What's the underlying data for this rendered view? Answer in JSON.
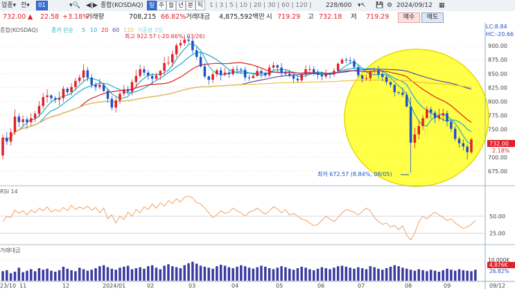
{
  "toolbar": {
    "item1": "업종",
    "item2": "전",
    "date_code": "01",
    "market_label": "종합(KOSDAQ)",
    "tab_day": "일",
    "tab_week": "주",
    "tab_month": "월",
    "tab_year": "년",
    "tab_min": "분",
    "tab_tick": "틱",
    "periods": [
      "1",
      "3",
      "5",
      "10",
      "20",
      "30",
      "60",
      "120"
    ],
    "count": "228/600",
    "date": "2024/09/12"
  },
  "info": {
    "price": "732.00",
    "price_arrow": "▲",
    "change": "22.58",
    "change_pct": "+3.18%",
    "volume_label": "거래량",
    "volume": "708,215",
    "ratio": "66.82%",
    "amount_label": "거래대금",
    "amount": "4,875,592백만",
    "open_label": "시",
    "open": "719.29",
    "high_label": "고",
    "high": "732.18",
    "low_label": "저",
    "low": "719.29",
    "buy": "매수",
    "sell": "매도"
  },
  "legend": {
    "name": "종합(KOSDAQ)",
    "ma_label": "종가 단순",
    "ma5": "5",
    "ma10": "10",
    "ma20": "20",
    "ma60": "60",
    "ma120": "120",
    "extra": "가중평 3일",
    "lc": "LC:8.84",
    "hc": "HC:-20.66",
    "max_annotation": "최고 922.57 (-20.66%, 03/26)",
    "min_annotation": "최저 672.57 (8.84%, 08/05)",
    "last_price_tag": "732.00",
    "last_pct_tag": "2.18%",
    "rsi_label": "RSI 14",
    "vol_label": "거래대금",
    "vol_last_tag": "4,876K",
    "vol_pct_tag": "26.82%"
  },
  "colors": {
    "up": "#e0202a",
    "down": "#1f52c7",
    "ma5": "#20b0b0",
    "ma10": "#1aa8d8",
    "ma20": "#e02020",
    "ma60": "#5a4aa8",
    "ma120": "#f0c040",
    "highlight": "#ffff00",
    "rsi": "#f2a060",
    "volume": "#3a3aa0"
  },
  "chart_data": {
    "type": "candlestick",
    "price_axis": {
      "ticks": [
        "900.00",
        "875.00",
        "850.00",
        "825.00",
        "800.00",
        "775.00",
        "750.00",
        "725.00",
        "700.00",
        "675.00"
      ],
      "range": [
        655,
        935
      ]
    },
    "rsi_axis": {
      "ticks": [
        "50.00",
        "25.00"
      ],
      "range": [
        10,
        90
      ]
    },
    "volume_axis": {
      "ticks": [
        "10,000K"
      ]
    },
    "x_ticks": [
      "23/10",
      "11",
      "12",
      "2024/01",
      "02",
      "03",
      "04",
      "05",
      "06",
      "07",
      "08",
      "09",
      "09/12"
    ],
    "candles": [
      [
        703,
        735,
        696,
        741,
        "up"
      ],
      [
        735,
        728,
        722,
        745,
        "down"
      ],
      [
        728,
        745,
        721,
        752,
        "up"
      ],
      [
        745,
        773,
        740,
        786,
        "up"
      ],
      [
        773,
        763,
        754,
        779,
        "down"
      ],
      [
        763,
        768,
        756,
        775,
        "up"
      ],
      [
        768,
        763,
        751,
        773,
        "down"
      ],
      [
        763,
        770,
        756,
        779,
        "up"
      ],
      [
        770,
        778,
        763,
        783,
        "up"
      ],
      [
        778,
        792,
        772,
        801,
        "up"
      ],
      [
        792,
        808,
        786,
        815,
        "up"
      ],
      [
        808,
        811,
        798,
        822,
        "up"
      ],
      [
        811,
        806,
        799,
        813,
        "down"
      ],
      [
        806,
        803,
        797,
        810,
        "down"
      ],
      [
        803,
        806,
        793,
        818,
        "up"
      ],
      [
        806,
        823,
        799,
        828,
        "up"
      ],
      [
        823,
        817,
        812,
        826,
        "down"
      ],
      [
        817,
        826,
        811,
        833,
        "up"
      ],
      [
        826,
        837,
        820,
        842,
        "up"
      ],
      [
        837,
        843,
        832,
        848,
        "up"
      ],
      [
        843,
        856,
        836,
        867,
        "up"
      ],
      [
        856,
        843,
        836,
        862,
        "down"
      ],
      [
        843,
        830,
        824,
        849,
        "down"
      ],
      [
        830,
        826,
        819,
        834,
        "down"
      ],
      [
        826,
        830,
        822,
        841,
        "up"
      ],
      [
        830,
        819,
        817,
        833,
        "down"
      ],
      [
        819,
        805,
        798,
        823,
        "down"
      ],
      [
        805,
        789,
        784,
        810,
        "down"
      ],
      [
        789,
        802,
        780,
        808,
        "up"
      ],
      [
        802,
        814,
        796,
        818,
        "up"
      ],
      [
        814,
        822,
        809,
        830,
        "up"
      ],
      [
        822,
        818,
        812,
        828,
        "down"
      ],
      [
        818,
        835,
        811,
        840,
        "up"
      ],
      [
        835,
        846,
        825,
        857,
        "up"
      ],
      [
        846,
        858,
        842,
        866,
        "up"
      ],
      [
        858,
        852,
        846,
        864,
        "down"
      ],
      [
        852,
        846,
        839,
        857,
        "down"
      ],
      [
        846,
        841,
        831,
        851,
        "down"
      ],
      [
        841,
        847,
        838,
        852,
        "up"
      ],
      [
        847,
        855,
        839,
        857,
        "up"
      ],
      [
        855,
        869,
        848,
        880,
        "up"
      ],
      [
        869,
        870,
        865,
        881,
        "up"
      ],
      [
        870,
        885,
        862,
        892,
        "up"
      ],
      [
        885,
        901,
        879,
        905,
        "up"
      ],
      [
        901,
        905,
        896,
        911,
        "up"
      ],
      [
        905,
        911,
        900,
        920,
        "up"
      ],
      [
        911,
        909,
        904,
        918,
        "down"
      ],
      [
        909,
        892,
        886,
        914,
        "down"
      ],
      [
        892,
        880,
        875,
        898,
        "down"
      ],
      [
        880,
        863,
        861,
        888,
        "down"
      ],
      [
        863,
        845,
        841,
        869,
        "down"
      ],
      [
        845,
        839,
        830,
        847,
        "down"
      ],
      [
        839,
        849,
        833,
        853,
        "up"
      ],
      [
        849,
        856,
        844,
        859,
        "up"
      ],
      [
        856,
        848,
        838,
        862,
        "down"
      ],
      [
        848,
        852,
        845,
        860,
        "up"
      ],
      [
        852,
        849,
        842,
        857,
        "down"
      ],
      [
        849,
        858,
        846,
        863,
        "up"
      ],
      [
        858,
        858,
        850,
        864,
        "down"
      ],
      [
        858,
        857,
        850,
        861,
        "down"
      ],
      [
        857,
        843,
        837,
        862,
        "down"
      ],
      [
        843,
        842,
        837,
        848,
        "down"
      ],
      [
        842,
        846,
        842,
        848,
        "up"
      ],
      [
        846,
        855,
        844,
        862,
        "up"
      ],
      [
        855,
        851,
        842,
        858,
        "down"
      ],
      [
        851,
        847,
        843,
        854,
        "down"
      ],
      [
        847,
        861,
        844,
        866,
        "up"
      ],
      [
        861,
        865,
        856,
        871,
        "up"
      ],
      [
        865,
        861,
        853,
        867,
        "down"
      ],
      [
        861,
        851,
        844,
        869,
        "down"
      ],
      [
        851,
        850,
        846,
        857,
        "down"
      ],
      [
        850,
        846,
        843,
        857,
        "down"
      ],
      [
        846,
        841,
        834,
        850,
        "down"
      ],
      [
        841,
        838,
        834,
        846,
        "down"
      ],
      [
        838,
        849,
        835,
        850,
        "up"
      ],
      [
        849,
        858,
        843,
        865,
        "up"
      ],
      [
        858,
        858,
        852,
        865,
        "up"
      ],
      [
        858,
        852,
        846,
        864,
        "down"
      ],
      [
        852,
        848,
        840,
        858,
        "down"
      ],
      [
        848,
        845,
        838,
        854,
        "down"
      ],
      [
        845,
        850,
        841,
        858,
        "up"
      ],
      [
        850,
        849,
        841,
        851,
        "down"
      ],
      [
        849,
        855,
        845,
        860,
        "up"
      ],
      [
        855,
        868,
        852,
        870,
        "up"
      ],
      [
        868,
        875,
        869,
        878,
        "up"
      ],
      [
        875,
        874,
        869,
        879,
        "down"
      ],
      [
        874,
        873,
        867,
        880,
        "down"
      ],
      [
        873,
        862,
        858,
        878,
        "down"
      ],
      [
        862,
        847,
        843,
        866,
        "down"
      ],
      [
        847,
        841,
        834,
        848,
        "down"
      ],
      [
        841,
        842,
        838,
        849,
        "up"
      ],
      [
        842,
        854,
        837,
        856,
        "up"
      ],
      [
        854,
        856,
        850,
        858,
        "up"
      ],
      [
        856,
        849,
        841,
        864,
        "down"
      ],
      [
        849,
        844,
        836,
        856,
        "down"
      ],
      [
        844,
        835,
        830,
        848,
        "down"
      ],
      [
        835,
        830,
        825,
        836,
        "down"
      ],
      [
        830,
        817,
        809,
        831,
        "down"
      ],
      [
        817,
        816,
        812,
        818,
        "down"
      ],
      [
        816,
        812,
        808,
        825,
        "down"
      ],
      [
        812,
        791,
        789,
        817,
        "down"
      ],
      [
        791,
        726,
        672,
        808,
        "down"
      ],
      [
        726,
        741,
        716,
        753,
        "up"
      ],
      [
        741,
        756,
        732,
        766,
        "up"
      ],
      [
        756,
        770,
        749,
        776,
        "up"
      ],
      [
        770,
        786,
        770,
        792,
        "up"
      ],
      [
        786,
        780,
        769,
        791,
        "down"
      ],
      [
        780,
        770,
        761,
        784,
        "down"
      ],
      [
        770,
        775,
        766,
        787,
        "up"
      ],
      [
        775,
        779,
        764,
        787,
        "up"
      ],
      [
        779,
        764,
        755,
        784,
        "down"
      ],
      [
        764,
        751,
        745,
        767,
        "down"
      ],
      [
        751,
        733,
        729,
        756,
        "down"
      ],
      [
        733,
        725,
        717,
        737,
        "down"
      ],
      [
        725,
        719,
        712,
        732,
        "down"
      ],
      [
        719,
        709,
        696,
        723,
        "down"
      ],
      [
        709,
        732,
        706,
        735,
        "up"
      ]
    ],
    "rsi": [
      42,
      50,
      48,
      59,
      54,
      58,
      52,
      59,
      55,
      62,
      58,
      64,
      56,
      60,
      57,
      63,
      58,
      66,
      60,
      64,
      61,
      65,
      59,
      63,
      55,
      62,
      46,
      52,
      40,
      50,
      45,
      56,
      50,
      60,
      55,
      64,
      60,
      68,
      62,
      70,
      65,
      73,
      69,
      76,
      71,
      78,
      80,
      77,
      70,
      68,
      62,
      55,
      48,
      52,
      58,
      54,
      56,
      62,
      58,
      55,
      50,
      56,
      58,
      62,
      57,
      53,
      58,
      64,
      61,
      55,
      60,
      52,
      54,
      50,
      46,
      44,
      40,
      36,
      38,
      44,
      50,
      46,
      42,
      48,
      55,
      60,
      58,
      56,
      52,
      57,
      62,
      58,
      48,
      42,
      38,
      40,
      34,
      36,
      30,
      36,
      22,
      15,
      25,
      42,
      50,
      46,
      52,
      56,
      52,
      48,
      44,
      46,
      40,
      36,
      32,
      34,
      38,
      44
    ],
    "volume_pct": [
      38,
      42,
      30,
      36,
      52,
      34,
      40,
      46,
      38,
      50,
      44,
      48,
      40,
      36,
      42,
      56,
      48,
      42,
      38,
      52,
      46,
      40,
      44,
      50,
      58,
      62,
      54,
      48,
      44,
      52,
      56,
      60,
      46,
      50,
      54,
      48,
      58,
      62,
      52,
      46,
      60,
      66,
      58,
      54,
      50,
      62,
      70,
      76,
      68,
      60,
      56,
      52,
      48,
      58,
      64,
      60,
      54,
      50,
      56,
      62,
      58,
      52,
      48,
      54,
      60,
      56,
      50,
      46,
      52,
      58,
      54,
      48,
      44,
      50,
      56,
      52,
      46,
      42,
      48,
      54,
      50,
      46,
      52,
      58,
      60,
      56,
      52,
      48,
      54,
      50,
      46,
      58,
      54,
      48,
      44,
      50,
      56,
      62,
      58,
      52,
      48,
      44,
      40,
      46,
      42,
      38,
      44,
      40,
      36,
      42,
      48,
      44,
      40,
      46,
      42,
      40,
      38,
      44
    ]
  }
}
